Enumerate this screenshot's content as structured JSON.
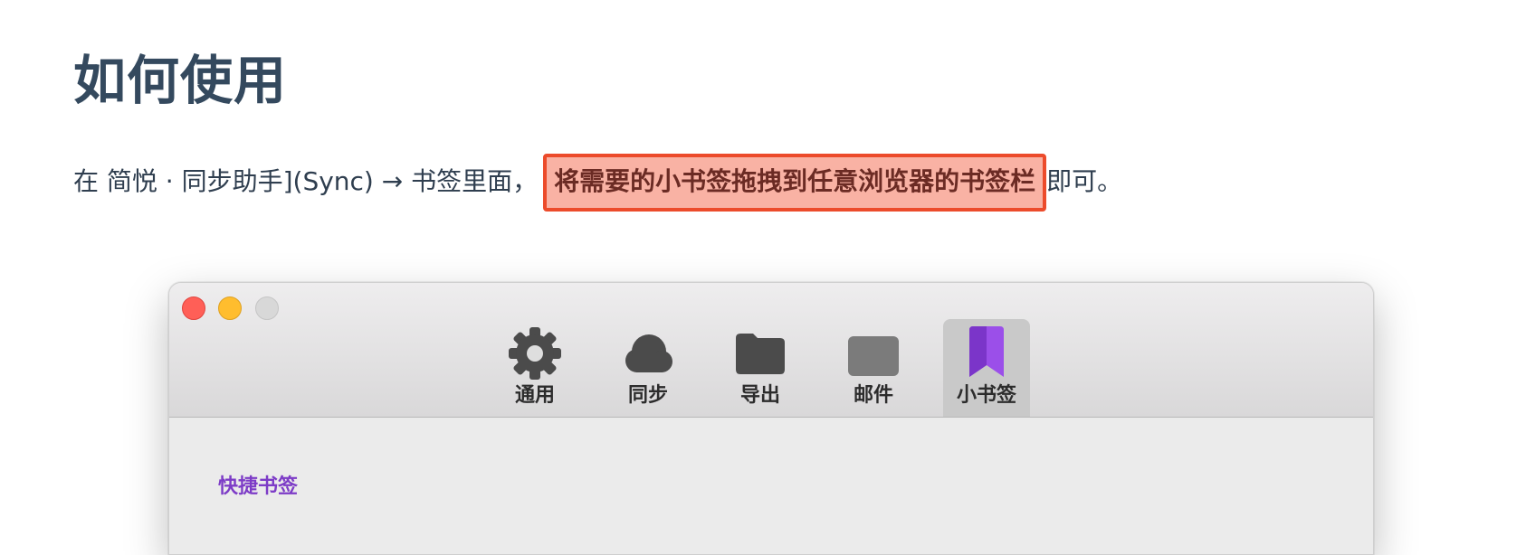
{
  "page": {
    "title": "如何使用",
    "intro_prefix": "在 简悦 · 同步助手](Sync) → 书签里面，",
    "intro_highlight": "将需要的小书签拖拽到任意浏览器的书签栏",
    "intro_suffix": "即可。"
  },
  "window": {
    "controls": [
      "close",
      "minimize",
      "zoom"
    ],
    "toolbar": {
      "items": [
        {
          "label": "通用",
          "icon": "gear-icon",
          "active": false
        },
        {
          "label": "同步",
          "icon": "cloud-icon",
          "active": false
        },
        {
          "label": "导出",
          "icon": "folder-icon",
          "active": false
        },
        {
          "label": "邮件",
          "icon": "mail-icon",
          "active": false
        },
        {
          "label": "小书签",
          "icon": "bookmark-icon",
          "active": true
        }
      ]
    },
    "content": {
      "section_label": "快捷书签"
    }
  },
  "colors": {
    "title": "#34495e",
    "highlight_bg": "#f9b2a4",
    "highlight_border": "#ec4b2b",
    "bookmark_accent": "#9b4fe9",
    "section_label": "#7d3cc7"
  }
}
